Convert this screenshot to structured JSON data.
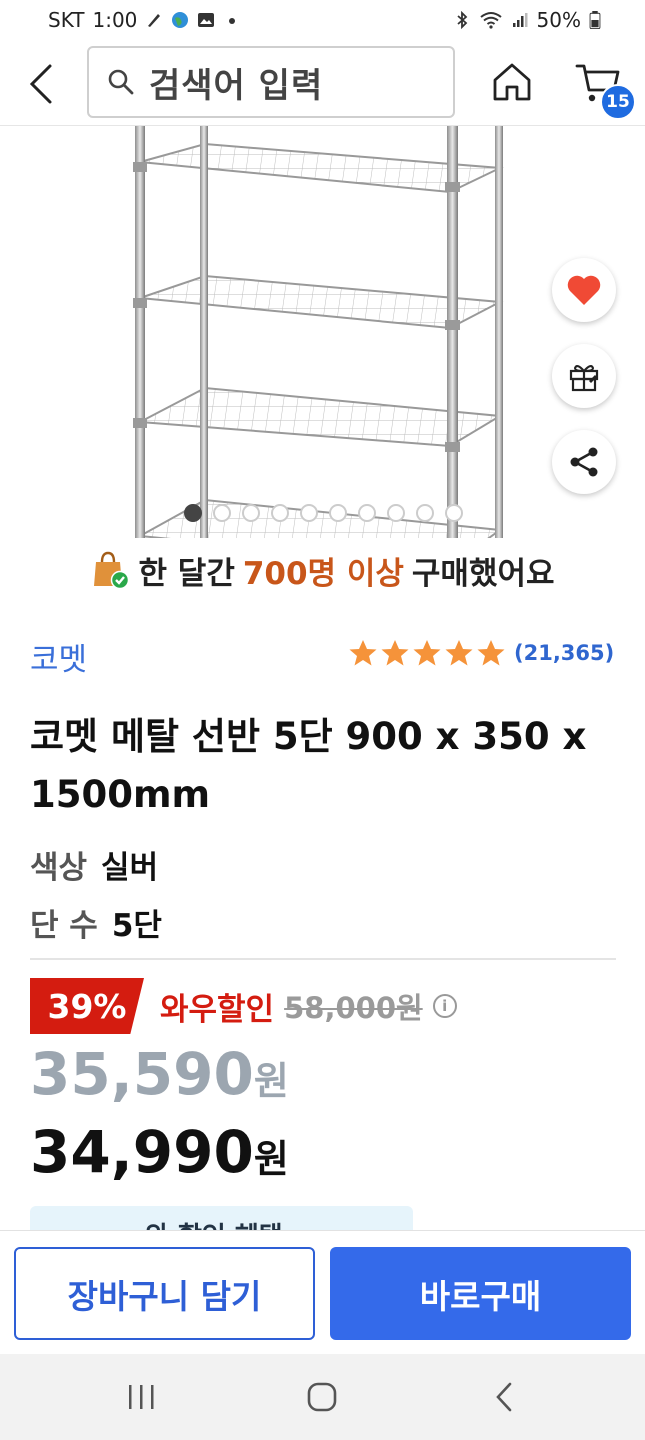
{
  "status_bar": {
    "carrier": "SKT",
    "time": "1:00",
    "battery": "50%"
  },
  "header": {
    "search_placeholder": "검색어 입력",
    "cart_count": "15"
  },
  "gallery": {
    "total_images": 10,
    "active_index": 0
  },
  "popularity": {
    "prefix": "한 달간",
    "highlight": "700명 이상",
    "suffix": "구매했어요"
  },
  "product": {
    "brand": "코멧",
    "rating_stars": 5,
    "review_count": "(21,365)",
    "title": "코멧 메탈 선반 5단 900 x 350 x 1500mm",
    "options": [
      {
        "key": "색상",
        "value": "실버"
      },
      {
        "key": "단 수",
        "value": "5단"
      }
    ]
  },
  "pricing": {
    "discount_rate": "39%",
    "discount_label": "와우할인",
    "original_price": "58,000원",
    "info_icon": "i",
    "sale_price_number": "35,590",
    "wow_price_number": "34,990",
    "currency": "원"
  },
  "peek_banner": {
    "text": "와 할인 혜택"
  },
  "actions": {
    "add_to_cart": "장바구니 담기",
    "buy_now": "바로구매"
  },
  "colors": {
    "accent_blue": "#346aea",
    "discount_red": "#d41c10",
    "rating_star": "#f5933a",
    "highlight_orange": "#c8561a"
  }
}
